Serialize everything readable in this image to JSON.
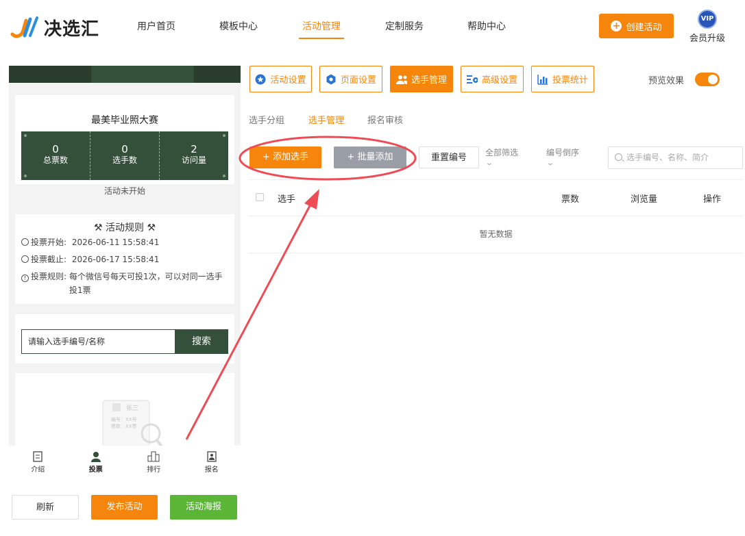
{
  "header": {
    "logo_text": "决选汇",
    "nav": [
      {
        "label": "用户首页"
      },
      {
        "label": "模板中心"
      },
      {
        "label": "活动管理"
      },
      {
        "label": "定制服务"
      },
      {
        "label": "帮助中心"
      }
    ],
    "active_nav": "活动管理",
    "create_button": "创建活动",
    "vip_badge": "VIP",
    "vip_label": "会员升级"
  },
  "preview": {
    "activity_title": "最美毕业照大赛",
    "stats": [
      {
        "value": "0",
        "label": "总票数"
      },
      {
        "value": "0",
        "label": "选手数"
      },
      {
        "value": "2",
        "label": "访问量"
      }
    ],
    "status": "活动未开始",
    "rules_title": "活动规则",
    "rules": [
      {
        "label": "投票开始:",
        "value": "2026-06-11 15:58:41"
      },
      {
        "label": "投票截止:",
        "value": "2026-06-17 15:58:41"
      },
      {
        "label": "投票规则:",
        "value": "每个微信号每天可投1次，可以对同一选手投1票"
      }
    ],
    "search_placeholder": "请输入选手编号/名称",
    "search_button": "搜索",
    "illustration": {
      "name": "张三",
      "line1": "编号：XX号",
      "line2": "票数：XX票"
    },
    "tabbar": [
      {
        "label": "介绍",
        "icon": "intro-icon"
      },
      {
        "label": "投票",
        "icon": "user-icon"
      },
      {
        "label": "排行",
        "icon": "ranking-icon"
      },
      {
        "label": "报名",
        "icon": "signup-icon"
      }
    ],
    "active_tab": "投票"
  },
  "bottom_buttons": {
    "refresh": "刷新",
    "publish": "发布活动",
    "poster": "活动海报"
  },
  "toolbar": {
    "buttons": [
      {
        "label": "活动设置",
        "icon": "star-icon"
      },
      {
        "label": "页面设置",
        "icon": "gear-icon"
      },
      {
        "label": "选手管理",
        "icon": "users-icon"
      },
      {
        "label": "高级设置",
        "icon": "advanced-settings-icon"
      },
      {
        "label": "投票统计",
        "icon": "bar-chart-icon"
      }
    ],
    "active": "选手管理",
    "preview_label": "预览效果",
    "preview_on": true
  },
  "subtabs": [
    {
      "label": "选手分组"
    },
    {
      "label": "选手管理"
    },
    {
      "label": "报名审核"
    }
  ],
  "active_subtab": "选手管理",
  "actions": {
    "add": "+ 添加选手",
    "batch_add": "+ 批量添加",
    "renumber": "重置编号",
    "filter_all": "全部筛选",
    "sort": "编号倒序",
    "search_placeholder": "选手编号、名称、简介"
  },
  "table": {
    "columns": [
      "选手",
      "票数",
      "浏览量",
      "操作"
    ],
    "empty_text": "暂无数据"
  },
  "colors": {
    "accent": "#f5860b",
    "dark_green": "#34503a",
    "green": "#5bb536",
    "gray_button": "#9a9ea6",
    "annotation_red": "#ee4b55"
  }
}
